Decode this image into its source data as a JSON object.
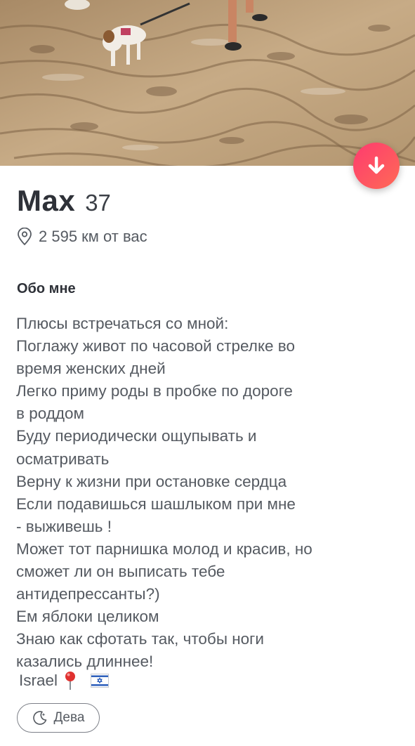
{
  "profile": {
    "name": "Max",
    "age": "37",
    "distance": "2 595 км от вас",
    "location": "Israel",
    "zodiac": "Дева"
  },
  "about": {
    "title": "Обо мне",
    "bio_lines": [
      "Плюсы встречаться со мной:",
      "Поглажу живот по часовой стрелке во",
      "время женских дней",
      "Легко приму роды в пробке по дороге",
      "в роддом",
      "Буду периодически ощупывать и",
      "осматривать",
      "Верну к жизни при остановке сердца",
      "Если подавишься шашлыком при мне",
      "- выживешь !",
      "Может тот парнишка молод и красив,  но",
      "сможет ли он выписать тебе",
      "антидепрессанты?)",
      "Ем яблоки целиком",
      "Знаю как сфотать так, чтобы ноги",
      "казались длиннее!"
    ]
  },
  "icons": {
    "collapse": "arrow-down-icon",
    "distance": "location-pin-icon",
    "location": "red-pushpin-icon",
    "flag": "israel-flag-icon",
    "zodiac": "crescent-moon-icon"
  },
  "colors": {
    "accent_start": "#fd3b6f",
    "accent_end": "#ff6a56",
    "name_text": "#2e3138",
    "body_text": "#555a61"
  }
}
